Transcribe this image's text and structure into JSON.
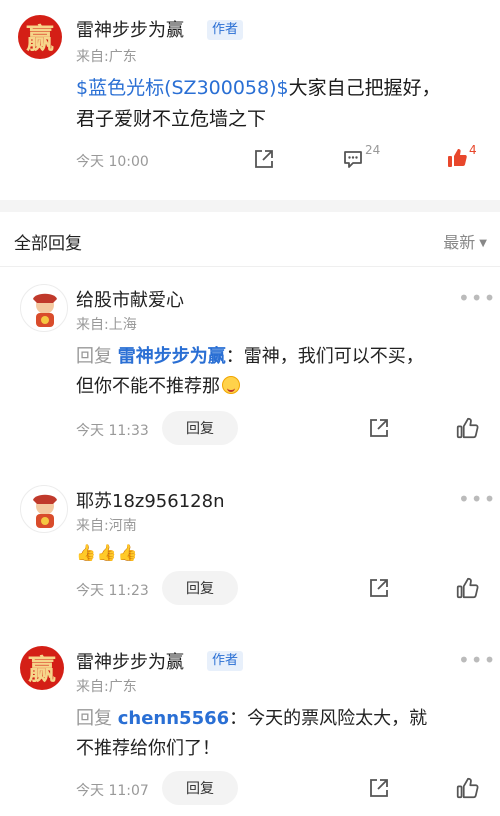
{
  "post": {
    "avatar_char": "赢",
    "username": "雷神步步为赢",
    "author_tag": "作者",
    "location": "来自:广东",
    "stock_link": "$蓝色光标(SZ300058)$",
    "text_rest": "大家自己把握好，",
    "text_line2": "君子爱财不立危墙之下",
    "time": "今天 10:00",
    "comment_count": "24",
    "like_count": "4",
    "icons": [
      "share-icon",
      "comment-icon",
      "thumbs-up-filled-icon"
    ],
    "accent": "#2a6fd4",
    "like_color": "#e8472c"
  },
  "section": {
    "title": "全部回复",
    "sort_label": "最新",
    "sort_caret": "▼"
  },
  "comments": [
    {
      "username": "给股市献爱心",
      "location": "来自:上海",
      "reply_prefix": "回复",
      "mention": "雷神步步为赢",
      "text_part1": "：雷神，我们可以不买，",
      "text_line2": "但你不能不推荐那",
      "time": "今天 11:33",
      "reply_label": "回复",
      "more": "•••"
    },
    {
      "username": "耶苏18z956128n",
      "location": "来自:河南",
      "content": "👍👍👍",
      "time": "今天 11:23",
      "reply_label": "回复",
      "more": "•••"
    },
    {
      "avatar_char": "赢",
      "username": "雷神步步为赢",
      "author_tag": "作者",
      "location": "来自:广东",
      "reply_prefix": "回复",
      "mention": "chenn5566",
      "text_part1": "：今天的票风险太大，就",
      "text_line2": "不推荐给你们了！",
      "time": "今天 11:07",
      "reply_label": "回复",
      "more": "•••"
    }
  ]
}
